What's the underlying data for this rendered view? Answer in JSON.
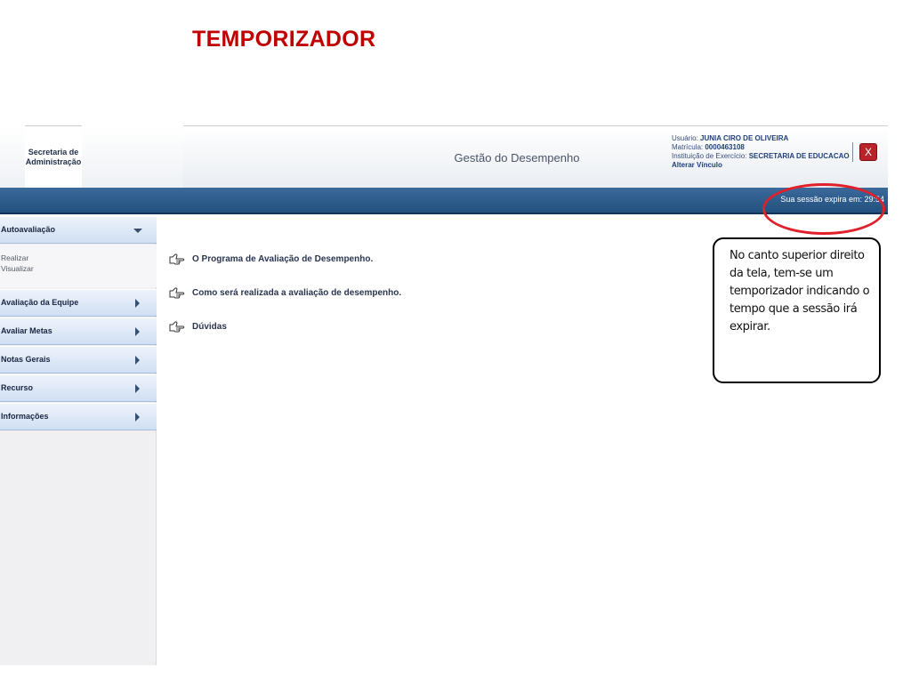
{
  "slide": {
    "title": "TEMPORIZADOR"
  },
  "header": {
    "logo_line1": "Secretaria de",
    "logo_line2": "Administração",
    "app_title": "Gestão do Desempenho",
    "user_label": "Usuário:",
    "user_value": "JUNIA CIRO DE OLIVEIRA",
    "matricula_label": "Matrícula:",
    "matricula_value": "0000463108",
    "instituicao_label": "Instituição de Exercício:",
    "instituicao_value": "SECRETARIA DE EDUCACAO",
    "alterar_link": "Alterar Vínculo",
    "close_label": "X"
  },
  "session": {
    "text": "Sua sessão expira em: 29:54"
  },
  "sidebar": {
    "items": [
      {
        "label": "Autoavaliação",
        "expanded": true
      },
      {
        "label": "Avaliação da Equipe",
        "expanded": false
      },
      {
        "label": "Avaliar Metas",
        "expanded": false
      },
      {
        "label": "Notas Gerais",
        "expanded": false
      },
      {
        "label": "Recurso",
        "expanded": false
      },
      {
        "label": "Informações",
        "expanded": false
      }
    ],
    "submenu": [
      "Realizar",
      "Visualizar"
    ]
  },
  "content": {
    "links": [
      "O Programa de Avaliação de Desempenho.",
      "Como será realizada a avaliação de desempenho.",
      "Dúvidas"
    ]
  },
  "callout": {
    "lines": [
      "No canto superior direito",
      "da tela, tem-se um",
      "temporizador indicando o",
      "tempo que a sessão irá",
      "expirar."
    ]
  },
  "colors": {
    "title_red": "#c00000",
    "header_blue": "#22507f",
    "highlight_red": "#e0202a",
    "close_red": "#b8242a"
  },
  "icons": [
    "pointing-hand-icon",
    "close-icon",
    "arrow-right-icon",
    "arrow-down-icon"
  ]
}
